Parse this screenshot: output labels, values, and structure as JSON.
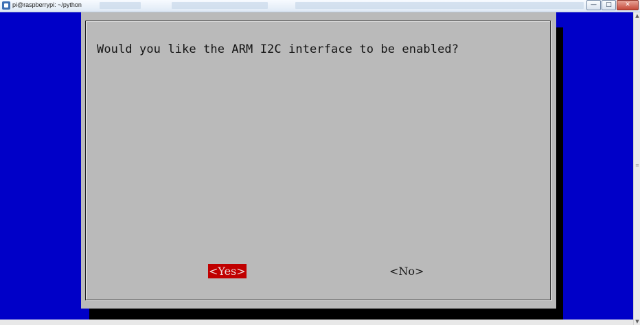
{
  "window": {
    "title": "pi@raspberrypi: ~/python",
    "controls": {
      "minimize": "—",
      "maximize": "□",
      "close": "✕"
    }
  },
  "dialog": {
    "question": "Would you like the ARM I2C interface to be enabled?",
    "yes_label": "<Yes>",
    "no_label": "<No>",
    "selected": "Yes"
  },
  "colors": {
    "terminal_bg": "#0000c8",
    "dialog_bg": "#bababa",
    "selected_button": "#c00000"
  },
  "icons": [
    "terminal-app-icon",
    "scroll-up-icon",
    "scroll-down-icon",
    "scroll-grip-icon"
  ]
}
